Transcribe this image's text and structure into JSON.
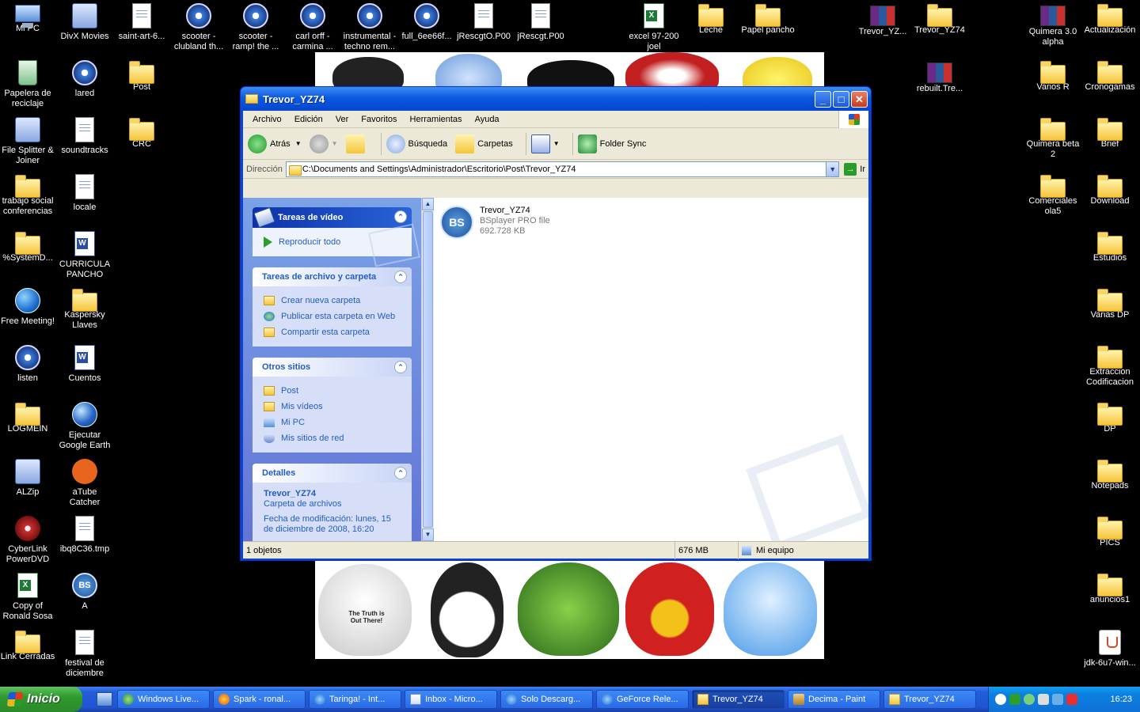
{
  "desktop": {
    "icons": [
      {
        "label": "Mi PC"
      },
      {
        "label": "DivX Movies"
      },
      {
        "label": "saint-art-6..."
      },
      {
        "label": "scooter - clubland th..."
      },
      {
        "label": "scooter - ramp! the ..."
      },
      {
        "label": "carl orff - carmina ..."
      },
      {
        "label": "instrumental - techno rem..."
      },
      {
        "label": "full_6ee66f..."
      },
      {
        "label": "jRescgtO.P00"
      },
      {
        "label": "jRescgt.P00"
      },
      {
        "label": "excel 97-200 joel"
      },
      {
        "label": "Leche"
      },
      {
        "label": "Papel pancho"
      },
      {
        "label": "Trevor_YZ..."
      },
      {
        "label": "Trevor_YZ74"
      },
      {
        "label": "Quimera 3.0 alpha"
      },
      {
        "label": "Actualización"
      },
      {
        "label": "Papelera de reciclaje"
      },
      {
        "label": "lared"
      },
      {
        "label": "Post"
      },
      {
        "label": "rebuilt.Tre..."
      },
      {
        "label": "Varios R"
      },
      {
        "label": "Cronogamas"
      },
      {
        "label": "File Splitter & Joiner"
      },
      {
        "label": "soundtracks"
      },
      {
        "label": "CRC"
      },
      {
        "label": "Quimera beta 2"
      },
      {
        "label": "Brief"
      },
      {
        "label": "trabajo social conferencias"
      },
      {
        "label": "locale"
      },
      {
        "label": "Comerciales ola5"
      },
      {
        "label": "Download"
      },
      {
        "label": "%SystemD..."
      },
      {
        "label": "CURRICULA PANCHO"
      },
      {
        "label": "Estudios"
      },
      {
        "label": "Free Meeting!"
      },
      {
        "label": "Kaspersky Llaves"
      },
      {
        "label": "Varias DP"
      },
      {
        "label": "listen"
      },
      {
        "label": "Cuentos"
      },
      {
        "label": "Extraccion Codificacion"
      },
      {
        "label": "LOGMEIN"
      },
      {
        "label": "Ejecutar Google Earth"
      },
      {
        "label": "DP"
      },
      {
        "label": "ALZip"
      },
      {
        "label": "aTube Catcher"
      },
      {
        "label": "Notepads"
      },
      {
        "label": "CyberLink PowerDVD"
      },
      {
        "label": "ibq8C36.tmp"
      },
      {
        "label": "PICS"
      },
      {
        "label": "Copy of Ronald Sosa"
      },
      {
        "label": "A"
      },
      {
        "label": "anuncios1"
      },
      {
        "label": "Link Cerradas"
      },
      {
        "label": "festival de diciembre"
      },
      {
        "label": "jdk-6u7-win..."
      }
    ],
    "wallpaper_text": "The Truth is Out There!"
  },
  "window": {
    "title": "Trevor_YZ74",
    "menu": [
      "Archivo",
      "Edición",
      "Ver",
      "Favoritos",
      "Herramientas",
      "Ayuda"
    ],
    "toolbar": {
      "back": "Atrás",
      "search": "Búsqueda",
      "folders": "Carpetas",
      "folder_sync": "Folder Sync"
    },
    "address": {
      "label": "Dirección",
      "value": "C:\\Documents and Settings\\Administrador\\Escritorio\\Post\\Trevor_YZ74",
      "go": "Ir"
    },
    "panels": {
      "video": {
        "title": "Tareas de vídeo",
        "items": [
          "Reproducir todo"
        ]
      },
      "file": {
        "title": "Tareas de archivo y carpeta",
        "items": [
          "Crear nueva carpeta",
          "Publicar esta carpeta en Web",
          "Compartir esta carpeta"
        ]
      },
      "other": {
        "title": "Otros sitios",
        "items": [
          "Post",
          "Mis vídeos",
          "Mi PC",
          "Mis sitios de red"
        ]
      },
      "details": {
        "title": "Detalles",
        "name": "Trevor_YZ74",
        "type": "Carpeta de archivos",
        "modified": "Fecha de modificación: lunes, 15 de diciembre de 2008, 16:20"
      }
    },
    "file": {
      "name": "Trevor_YZ74",
      "type": "BSplayer PRO file",
      "size": "692.728 KB",
      "icon_text": "BS"
    },
    "status": {
      "count": "1 objetos",
      "size": "676 MB",
      "location": "Mi equipo"
    }
  },
  "taskbar": {
    "start": "Inicio",
    "items": [
      {
        "label": "Windows Live..."
      },
      {
        "label": "Spark - ronal..."
      },
      {
        "label": "Taringa! - Int..."
      },
      {
        "label": "Inbox - Micro..."
      },
      {
        "label": "Solo Descarg..."
      },
      {
        "label": "GeForce Rele..."
      },
      {
        "label": "Trevor_YZ74"
      },
      {
        "label": "Decima - Paint"
      },
      {
        "label": "Trevor_YZ74"
      }
    ],
    "clock": "16:23"
  }
}
